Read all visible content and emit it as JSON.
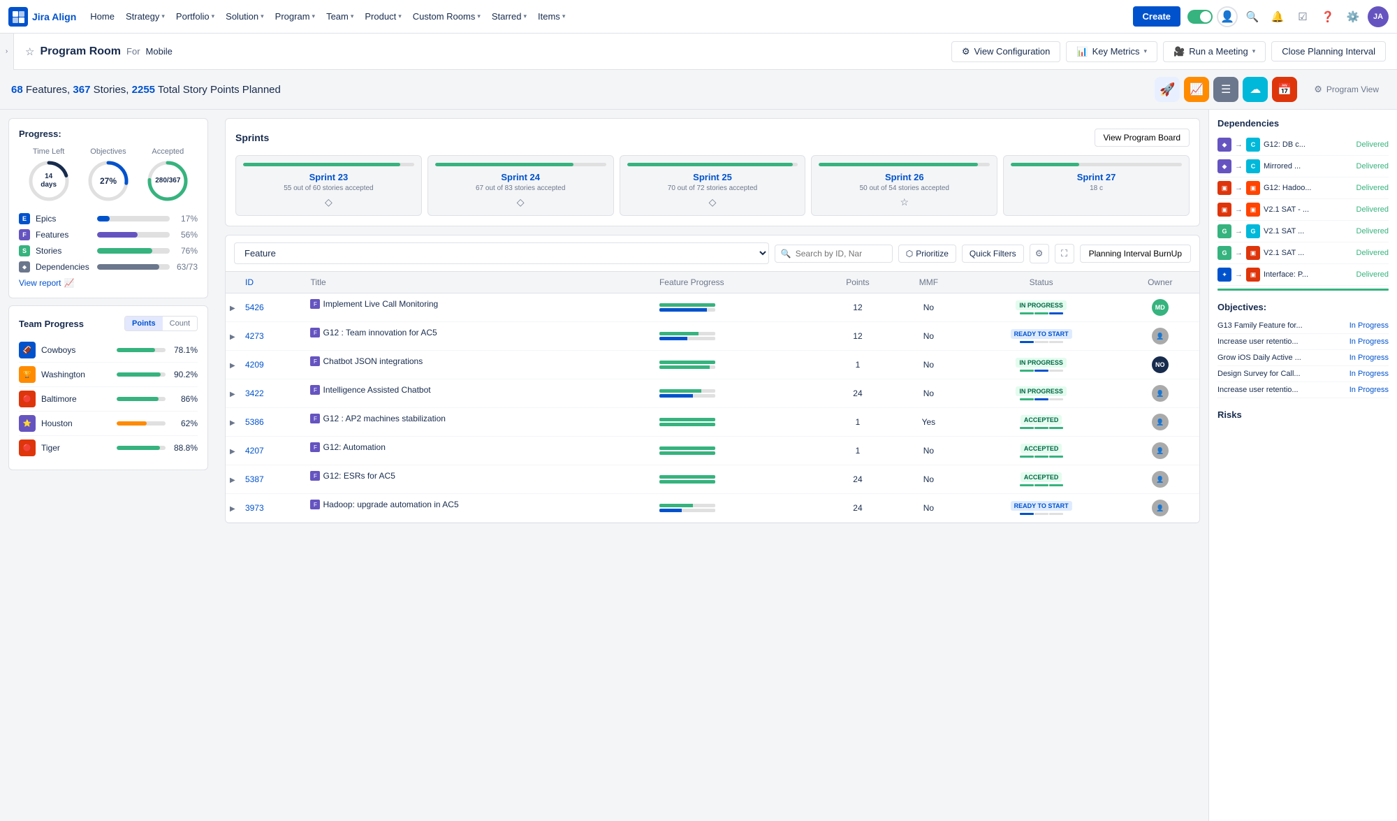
{
  "nav": {
    "logo_text": "Jira Align",
    "items": [
      {
        "label": "Home",
        "has_dropdown": false
      },
      {
        "label": "Strategy",
        "has_dropdown": true
      },
      {
        "label": "Portfolio",
        "has_dropdown": true
      },
      {
        "label": "Solution",
        "has_dropdown": true
      },
      {
        "label": "Program",
        "has_dropdown": true
      },
      {
        "label": "Team",
        "has_dropdown": true
      },
      {
        "label": "Product",
        "has_dropdown": true
      },
      {
        "label": "Custom Rooms",
        "has_dropdown": true
      },
      {
        "label": "Starred",
        "has_dropdown": true
      },
      {
        "label": "Items",
        "has_dropdown": true
      }
    ],
    "create_label": "Create"
  },
  "subheader": {
    "title": "Program Room",
    "for_label": "For",
    "room_name": "Mobile",
    "buttons": {
      "view_config": "View Configuration",
      "key_metrics": "Key Metrics",
      "run_meeting": "Run a Meeting",
      "close_interval": "Close Planning Interval"
    }
  },
  "summary": {
    "features_count": "68",
    "stories_count": "367",
    "points_count": "2255",
    "features_label": "Features,",
    "stories_label": "Stories,",
    "points_label": "Total Story Points Planned",
    "program_view_label": "Program View"
  },
  "progress": {
    "title": "Progress:",
    "circles": [
      {
        "label": "Time Left",
        "value": "14 days",
        "pct": 0,
        "type": "dark"
      },
      {
        "label": "Objectives",
        "value": "27%",
        "pct": 27,
        "type": "blue"
      },
      {
        "label": "Accepted",
        "value": "280/367",
        "pct": 76,
        "type": "green"
      }
    ],
    "items": [
      {
        "icon": "E",
        "label": "Epics",
        "pct": 17,
        "bar_class": "bar-epics",
        "icon_class": "icon-epics"
      },
      {
        "icon": "F",
        "label": "Features",
        "pct": 56,
        "bar_class": "bar-features",
        "icon_class": "icon-features"
      },
      {
        "icon": "S",
        "label": "Stories",
        "pct": 76,
        "bar_class": "bar-stories",
        "icon_class": "icon-stories"
      },
      {
        "icon": "D",
        "label": "Dependencies",
        "pct": 86,
        "bar_class": "bar-deps",
        "icon_class": "icon-deps",
        "value": "63/73"
      }
    ],
    "view_report_label": "View report"
  },
  "team_progress": {
    "title": "Team Progress",
    "tabs": [
      "Points",
      "Count"
    ],
    "active_tab": "Points",
    "teams": [
      {
        "name": "Cowboys",
        "pct": "78.1%",
        "bar_pct": 78,
        "color": "#0052cc"
      },
      {
        "name": "Washington",
        "pct": "90.2%",
        "bar_pct": 90,
        "color": "#de350b"
      },
      {
        "name": "Baltimore",
        "pct": "86%",
        "bar_pct": 86,
        "color": "#de350b"
      },
      {
        "name": "Houston",
        "pct": "62%",
        "bar_pct": 62,
        "color": "#ff8b00"
      },
      {
        "name": "Tiger",
        "pct": "88.8%",
        "bar_pct": 89,
        "color": "#de350b"
      }
    ]
  },
  "sprints": {
    "title": "Sprints",
    "view_board_label": "View Program Board",
    "items": [
      {
        "name": "Sprint 23",
        "subtitle": "55 out of 60 stories accepted",
        "pct": 92
      },
      {
        "name": "Sprint 24",
        "subtitle": "67 out of 83 stories accepted",
        "pct": 81
      },
      {
        "name": "Sprint 25",
        "subtitle": "70 out of 72 stories accepted",
        "pct": 97
      },
      {
        "name": "Sprint 26",
        "subtitle": "50 out of 54 stories accepted",
        "pct": 93
      },
      {
        "name": "Sprint 27",
        "subtitle": "18 c",
        "pct": 40
      }
    ]
  },
  "feature_table": {
    "dropdown_value": "Feature",
    "search_placeholder": "Search by ID, Nar",
    "toolbar": {
      "prioritize": "Prioritize",
      "quick_filters": "Quick Filters",
      "burnup": "Planning Interval BurnUp"
    },
    "columns": [
      "",
      "ID",
      "Title",
      "Feature Progress",
      "Points",
      "MMF",
      "Status",
      "Owner"
    ],
    "rows": [
      {
        "expand": true,
        "id": "5426",
        "title": "Implement Live Call Monitoring",
        "progress": 85,
        "points": 12,
        "mmf": "No",
        "status": "IN PROGRESS",
        "status_class": "status-in-progress",
        "owner_color": "#36b37e",
        "owner_initials": "MD"
      },
      {
        "expand": true,
        "id": "4273",
        "title": "G12 : Team innovation for AC5",
        "progress": 70,
        "points": 12,
        "mmf": "No",
        "status": "READY TO START",
        "status_class": "status-ready",
        "owner_color": "#6b778c",
        "owner_initials": ""
      },
      {
        "expand": true,
        "id": "4209",
        "title": "Chatbot JSON integrations",
        "progress": 90,
        "points": 1,
        "mmf": "No",
        "status": "IN PROGRESS",
        "status_class": "status-in-progress",
        "owner_color": "#172b4d",
        "owner_initials": "NO"
      },
      {
        "expand": true,
        "id": "3422",
        "title": "Intelligence Assisted Chatbot",
        "progress": 75,
        "points": 24,
        "mmf": "No",
        "status": "IN PROGRESS",
        "status_class": "status-in-progress",
        "owner_color": "#6b778c",
        "owner_initials": ""
      },
      {
        "expand": true,
        "id": "5386",
        "title": "G12 : AP2 machines stabilization",
        "progress": 95,
        "points": 1,
        "mmf": "Yes",
        "status": "ACCEPTED",
        "status_class": "status-accepted",
        "owner_color": "#6b778c",
        "owner_initials": ""
      },
      {
        "expand": true,
        "id": "4207",
        "title": "G12: Automation",
        "progress": 88,
        "points": 1,
        "mmf": "No",
        "status": "ACCEPTED",
        "status_class": "status-accepted",
        "owner_color": "#6b778c",
        "owner_initials": ""
      },
      {
        "expand": true,
        "id": "5387",
        "title": "G12: ESRs for AC5",
        "progress": 82,
        "points": 24,
        "mmf": "No",
        "status": "ACCEPTED",
        "status_class": "status-accepted",
        "owner_color": "#6b778c",
        "owner_initials": ""
      },
      {
        "expand": true,
        "id": "3973",
        "title": "Hadoop: upgrade automation in AC5",
        "progress": 60,
        "points": 24,
        "mmf": "No",
        "status": "READY TO START",
        "status_class": "status-ready",
        "owner_color": "#6b778c",
        "owner_initials": ""
      }
    ]
  },
  "dependencies": {
    "title": "Dependencies",
    "items": [
      {
        "from_color": "#6554c0",
        "from_icon": "◆",
        "to_color": "#00b8d9",
        "to_text": "Cha",
        "text": "G12: DB c...",
        "status": "Delivered"
      },
      {
        "from_color": "#6554c0",
        "from_icon": "◆",
        "to_color": "#00b8d9",
        "to_text": "Cha",
        "text": "Mirrored ...",
        "status": "Delivered"
      },
      {
        "from_color": "#de350b",
        "from_icon": "▣",
        "to_color": "#ff4400",
        "to_text": "",
        "text": "G12: Hadoo...",
        "status": "Delivered"
      },
      {
        "from_color": "#de350b",
        "from_icon": "▣",
        "to_color": "#ff4400",
        "to_text": "",
        "text": "V2.1 SAT - ...",
        "status": "Delivered"
      },
      {
        "from_color": "#36b37e",
        "from_icon": "G",
        "to_color": "#00b8d9",
        "to_text": "G",
        "text": "V2.1 SAT ...",
        "status": "Delivered"
      },
      {
        "from_color": "#36b37e",
        "from_icon": "G",
        "to_color": "#de350b",
        "to_text": "",
        "text": "V2.1 SAT ...",
        "status": "Delivered"
      },
      {
        "from_color": "#0052cc",
        "from_icon": "⬥",
        "to_color": "#de350b",
        "to_text": "",
        "text": "Interface: P...",
        "status": "Delivered"
      }
    ]
  },
  "objectives": {
    "title": "Objectives:",
    "items": [
      {
        "text": "G13 Family Feature for...",
        "status": "In Progress"
      },
      {
        "text": "Increase user retentio...",
        "status": "In Progress"
      },
      {
        "text": "Grow iOS Daily Active ...",
        "status": "In Progress"
      },
      {
        "text": "Design Survey for Call...",
        "status": "In Progress"
      },
      {
        "text": "Increase user retentio...",
        "status": "In Progress"
      }
    ]
  },
  "risks": {
    "title": "Risks"
  }
}
